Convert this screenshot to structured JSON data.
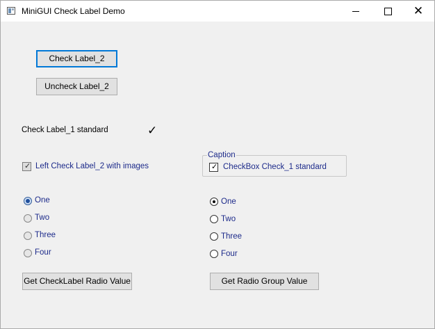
{
  "window": {
    "title": "MiniGUI Check Label Demo",
    "controls": {
      "minimize": "minimize",
      "maximize": "maximize",
      "close": "✕"
    }
  },
  "buttons": {
    "check_label_2": "Check Label_2",
    "uncheck_label_2": "Uncheck Label_2",
    "get_checklabel_radio": "Get CheckLabel Radio Value",
    "get_radio_group": "Get Radio Group Value"
  },
  "check_label_1": {
    "text": "Check Label_1 standard",
    "checked": true,
    "mark": "✓"
  },
  "left_check_label_2": {
    "text": "Left Check Label_2 with images",
    "checked": true,
    "mark": "✓"
  },
  "group": {
    "caption": "Caption",
    "checkbox": {
      "text": "CheckBox Check_1 standard",
      "checked": true,
      "mark": "✓"
    }
  },
  "checklabel_radio": {
    "options": [
      "One",
      "Two",
      "Three",
      "Four"
    ],
    "selected": "One"
  },
  "radio_group": {
    "options": [
      "One",
      "Two",
      "Three",
      "Four"
    ],
    "selected": "One"
  },
  "colors": {
    "focus": "#0078d7",
    "label_navy": "#1c2a8a",
    "background": "#f0f0f0"
  }
}
